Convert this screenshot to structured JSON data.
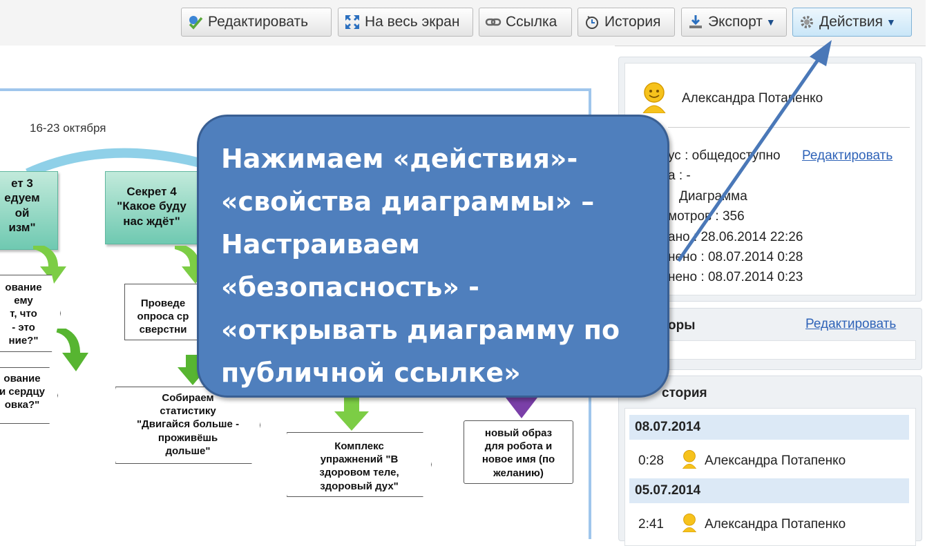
{
  "toolbar": {
    "edit": "Редактировать",
    "fullscreen": "На весь экран",
    "link": "Ссылка",
    "history": "История",
    "export": "Экспорт",
    "actions": "Действия"
  },
  "diagram": {
    "date_label": "16-23 октября",
    "secret3": [
      "ет 3",
      "едуем",
      "ой",
      "изм\""
    ],
    "secret4": [
      "Секрет 4",
      "\"Какое буду",
      "нас ждёт\""
    ],
    "left_shape1": [
      "ование",
      "ему",
      "т, что",
      "- это",
      "ние?\""
    ],
    "left_shape2": [
      "ование",
      "и сердцу",
      "овка?\""
    ],
    "survey": [
      "Проведе",
      "опроса ср",
      "сверстни"
    ],
    "stats": [
      "Собираем",
      "статистику",
      "\"Двигайся больше -",
      "проживёшь",
      "дольше\""
    ],
    "exercises": [
      "Комплекс",
      "упражнений \"В",
      "здоровом теле,",
      "здоровый дух\""
    ],
    "robot": [
      "новый образ",
      "для робота и",
      "новое имя (по",
      "желанию)"
    ]
  },
  "sidebar": {
    "author": "Александра Потапенко",
    "status_label": "ус : общедоступно",
    "status_edit": "Редактировать",
    "line2": "а : -",
    "line3": "Диаграмма",
    "views": "мотров : 356",
    "created": "ано : 28.06.2014 22:26",
    "changed": "нено : 08.07.2014 0:28",
    "modified": "нено : 08.07.2014 0:23",
    "coauthors_label": "торы",
    "coauthors_edit": "Редактировать",
    "history_label": "стория",
    "history": [
      {
        "date": "08.07.2014",
        "time": "0:28",
        "user": "Александра Потапенко"
      },
      {
        "date": "05.07.2014",
        "time": "2:41",
        "user": "Александра Потапенко"
      }
    ]
  },
  "callout": {
    "lines": [
      "Нажимаем «действия»-",
      "«свойства диаграммы» –",
      "Настраиваем",
      "«безопасность» -",
      "«открывать диаграмму по",
      "публичной ссылке»"
    ]
  },
  "colors": {
    "callout_bg": "#4f7fbd",
    "teal": "#6fc9b1",
    "highlight": "#dce9f6",
    "link": "#2f63b8"
  }
}
